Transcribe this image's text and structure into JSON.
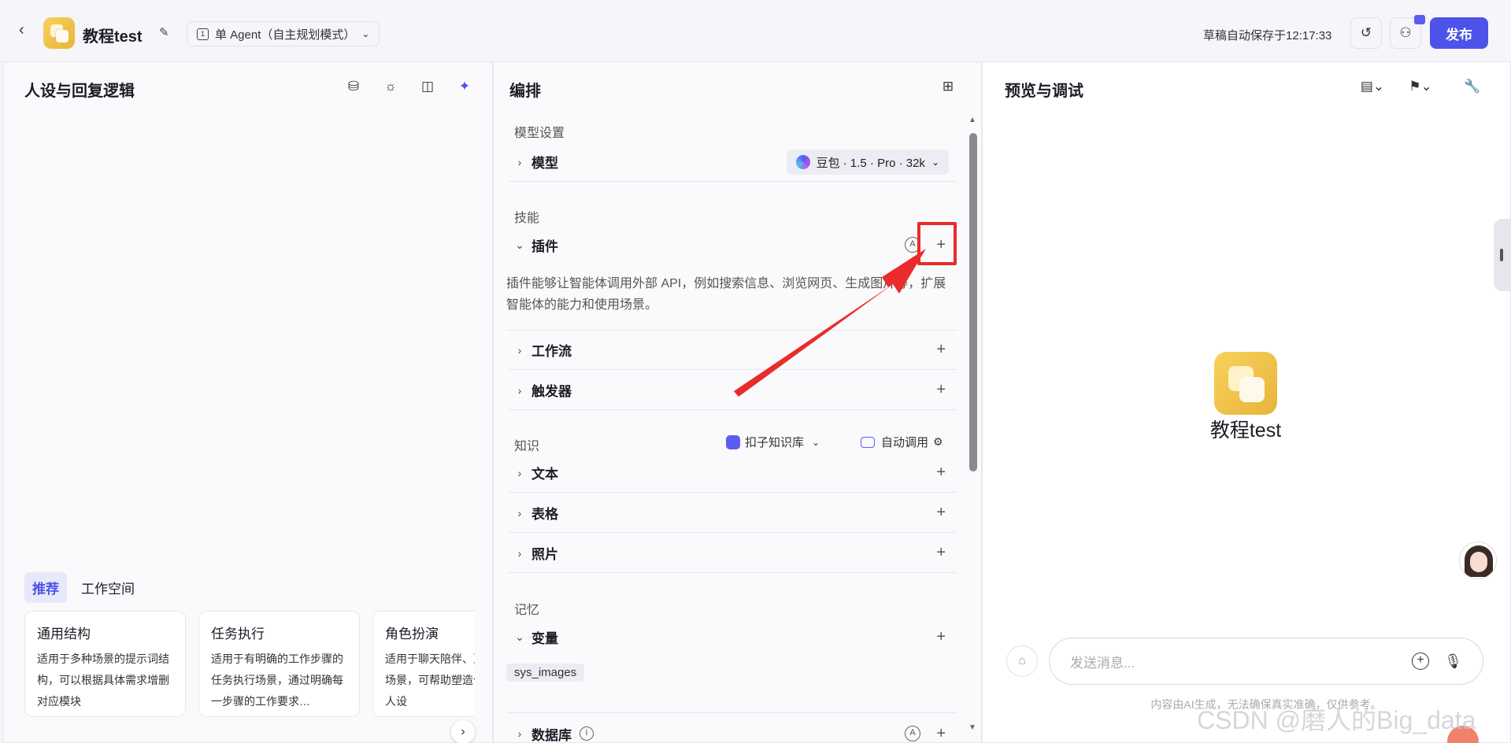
{
  "header": {
    "app_name": "教程test",
    "mode_label": "单 Agent（自主规划模式）",
    "mode_icon_text": "1",
    "save_status": "草稿自动保存于12:17:33",
    "publish_label": "发布"
  },
  "left_panel": {
    "title": "人设与回复逻辑",
    "tabs": [
      "推荐",
      "工作空间"
    ],
    "cards": [
      {
        "title": "通用结构",
        "desc": "适用于多种场景的提示词结构，可以根据具体需求增删对应模块"
      },
      {
        "title": "任务执行",
        "desc": "适用于有明确的工作步骤的任务执行场景，通过明确每一步骤的工作要求…"
      },
      {
        "title": "角色扮演",
        "desc": "适用于聊天陪伴、互动娱乐场景，可帮助塑造个性化的人设"
      }
    ]
  },
  "mid_panel": {
    "title": "编排",
    "model_section": "模型设置",
    "model_label": "模型",
    "model_value": "豆包 · 1.5 · Pro · 32k",
    "skills_section": "技能",
    "plugin_label": "插件",
    "plugin_auto_icon": "A",
    "plugin_desc": "插件能够让智能体调用外部 API，例如搜索信息、浏览网页、生成图片等，扩展智能体的能力和使用场景。",
    "workflow_label": "工作流",
    "trigger_label": "触发器",
    "knowledge_section": "知识",
    "kb_select": "扣子知识库",
    "kb_auto": "自动调用",
    "text_label": "文本",
    "table_label": "表格",
    "photo_label": "照片",
    "memory_section": "记忆",
    "variable_label": "变量",
    "variable_tag": "sys_images",
    "database_label": "数据库",
    "database_auto_icon": "A"
  },
  "right_panel": {
    "title": "预览与调试",
    "bot_name": "教程test",
    "input_placeholder": "发送消息...",
    "disclaimer": "内容由AI生成，无法确保真实准确，仅供参考。",
    "watermark": "CSDN @磨人的Big_data"
  },
  "colors": {
    "accent": "#4d53e8",
    "highlight_red": "#ea2b2b",
    "app_icon": "#f0c24a"
  },
  "icons": {
    "back": "chevron-left-icon",
    "edit": "edit-icon",
    "history": "history-icon",
    "collaborate": "users-icon",
    "plus": "plus-icon",
    "mic": "mic-icon"
  }
}
